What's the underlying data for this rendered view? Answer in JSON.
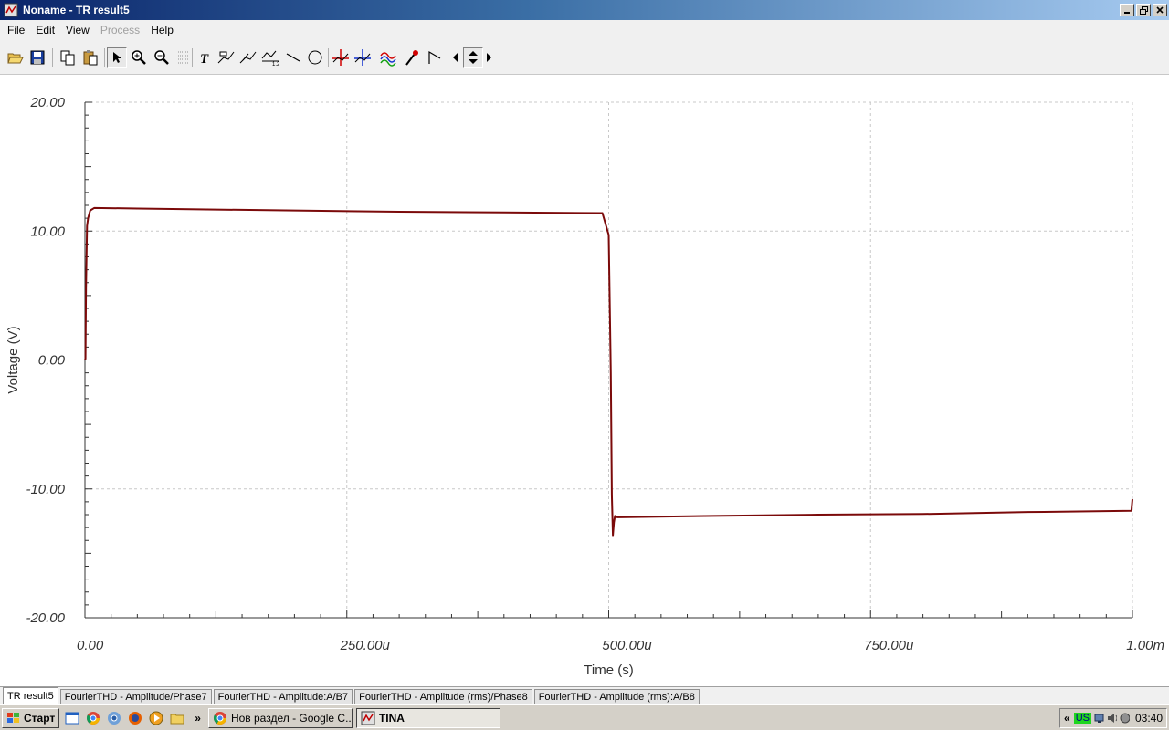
{
  "window": {
    "title": "Noname - TR result5"
  },
  "menu": [
    {
      "label": "File",
      "enabled": true
    },
    {
      "label": "Edit",
      "enabled": true
    },
    {
      "label": "View",
      "enabled": true
    },
    {
      "label": "Process",
      "enabled": false
    },
    {
      "label": "Help",
      "enabled": true
    }
  ],
  "toolbar": {
    "buttons": [
      "open-icon",
      "save-icon",
      "copy-icon",
      "paste-icon",
      "pointer-icon",
      "zoom-in-icon",
      "zoom-out-icon",
      "grid-icon",
      "text-icon",
      "label-curve-icon",
      "label-curve-2-icon",
      "annotation-icon",
      "line-icon",
      "circle-icon",
      "cursor-a-icon",
      "cursor-b-icon",
      "curves-icon",
      "probe-icon",
      "step-icon",
      "arrow-left-icon",
      "arrow-updown-icon",
      "arrow-right-icon"
    ]
  },
  "chart_data": {
    "type": "line",
    "ylabel": "Voltage (V)",
    "xlabel": "Time (s)",
    "xlim": [
      0,
      0.001
    ],
    "ylim": [
      -20,
      20
    ],
    "x_tick_labels": [
      "0.00",
      "250.00u",
      "500.00u",
      "750.00u",
      "1.00m"
    ],
    "y_tick_labels": [
      "20.00",
      "10.00",
      "0.00",
      "-10.00",
      "-20.00"
    ],
    "y_ticks": [
      20,
      10,
      0,
      -10,
      -20
    ],
    "x_ticks": [
      0,
      0.00025,
      0.0005,
      0.00075,
      0.001
    ],
    "grid": true,
    "series": [
      {
        "color": "#7b0a0a",
        "x": [
          0,
          5e-07,
          1e-06,
          1.5e-06,
          2e-06,
          3e-06,
          5e-06,
          9e-06,
          5e-05,
          0.0001,
          0.0002,
          0.0003,
          0.0004,
          0.000494,
          0.0005,
          0.000502,
          0.000503,
          0.000504,
          0.000505,
          0.000506,
          0.000508,
          0.00051,
          0.0006,
          0.0007,
          0.0008,
          0.0009,
          0.000999,
          0.001
        ],
        "y": [
          0,
          0.1,
          5.6,
          8.0,
          10.4,
          11.0,
          11.6,
          11.8,
          11.75,
          11.7,
          11.6,
          11.5,
          11.45,
          11.4,
          9.7,
          -1.0,
          -10.5,
          -13.6,
          -12.6,
          -12.1,
          -12.2,
          -12.2,
          -12.1,
          -12.0,
          -11.95,
          -11.8,
          -11.7,
          -10.8
        ]
      }
    ]
  },
  "tabs": [
    {
      "label": "TR result5",
      "active": true
    },
    {
      "label": "FourierTHD - Amplitude/Phase7",
      "active": false
    },
    {
      "label": "FourierTHD - Amplitude:A/B7",
      "active": false
    },
    {
      "label": "FourierTHD - Amplitude (rms)/Phase8",
      "active": false
    },
    {
      "label": "FourierTHD - Amplitude (rms):A/B8",
      "active": false
    }
  ],
  "taskbar": {
    "start_label": "Старт",
    "chevron": "»",
    "tasks": [
      {
        "label": "Нов раздел - Google C...",
        "active": false
      },
      {
        "label": "TINA",
        "active": true
      }
    ],
    "tray": {
      "expand": "«",
      "lang": "US",
      "time": "03:40"
    }
  }
}
